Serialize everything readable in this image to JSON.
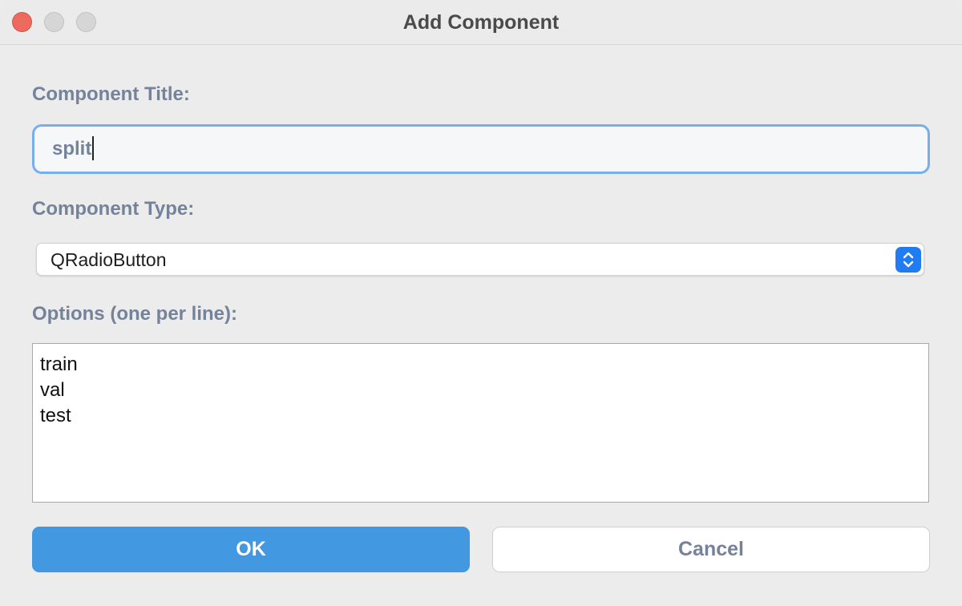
{
  "window": {
    "title": "Add Component"
  },
  "form": {
    "title_label": "Component Title:",
    "title_value": "split",
    "type_label": "Component Type:",
    "type_value": "QRadioButton",
    "options_label": "Options (one per line):",
    "options": [
      "train",
      "val",
      "test"
    ]
  },
  "buttons": {
    "ok_label": "OK",
    "cancel_label": "Cancel"
  },
  "colors": {
    "accent": "#4398e2",
    "focus_ring": "#76aeee",
    "label_text": "#75839a",
    "close_button": "#ed6a5e"
  },
  "icons": {
    "window_close": "close-icon",
    "window_minimize": "minimize-icon",
    "window_maximize": "maximize-icon",
    "select_stepper": "chevron-up-down-icon"
  }
}
